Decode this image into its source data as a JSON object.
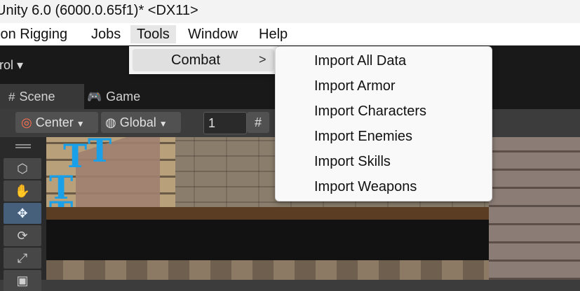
{
  "window": {
    "title": "Unity 6.0 (6000.0.65f1)* <DX11>"
  },
  "menubar": {
    "items": [
      {
        "label": "ion Rigging"
      },
      {
        "label": "Jobs"
      },
      {
        "label": "Tools"
      },
      {
        "label": "Window"
      },
      {
        "label": "Help"
      }
    ]
  },
  "toolbar": {
    "control_label": "trol ▾"
  },
  "tabs": [
    {
      "label": "Scene",
      "icon": "grid-icon"
    },
    {
      "label": "Game",
      "icon": "gamepad-icon"
    }
  ],
  "scene_toolbar": {
    "pivot_label": "Center",
    "space_label": "Global",
    "snap_value": "1"
  },
  "tools_menu": {
    "item": "Combat",
    "arrow": ">"
  },
  "combat_submenu": {
    "items": [
      "Import All Data",
      "Import Armor",
      "Import Characters",
      "Import Enemies",
      "Import Skills",
      "Import Weapons"
    ]
  },
  "colors": {
    "accent": "#46607c",
    "menu_bg": "#f9f9f9",
    "scene_gizmo": "#1aa0e8"
  }
}
